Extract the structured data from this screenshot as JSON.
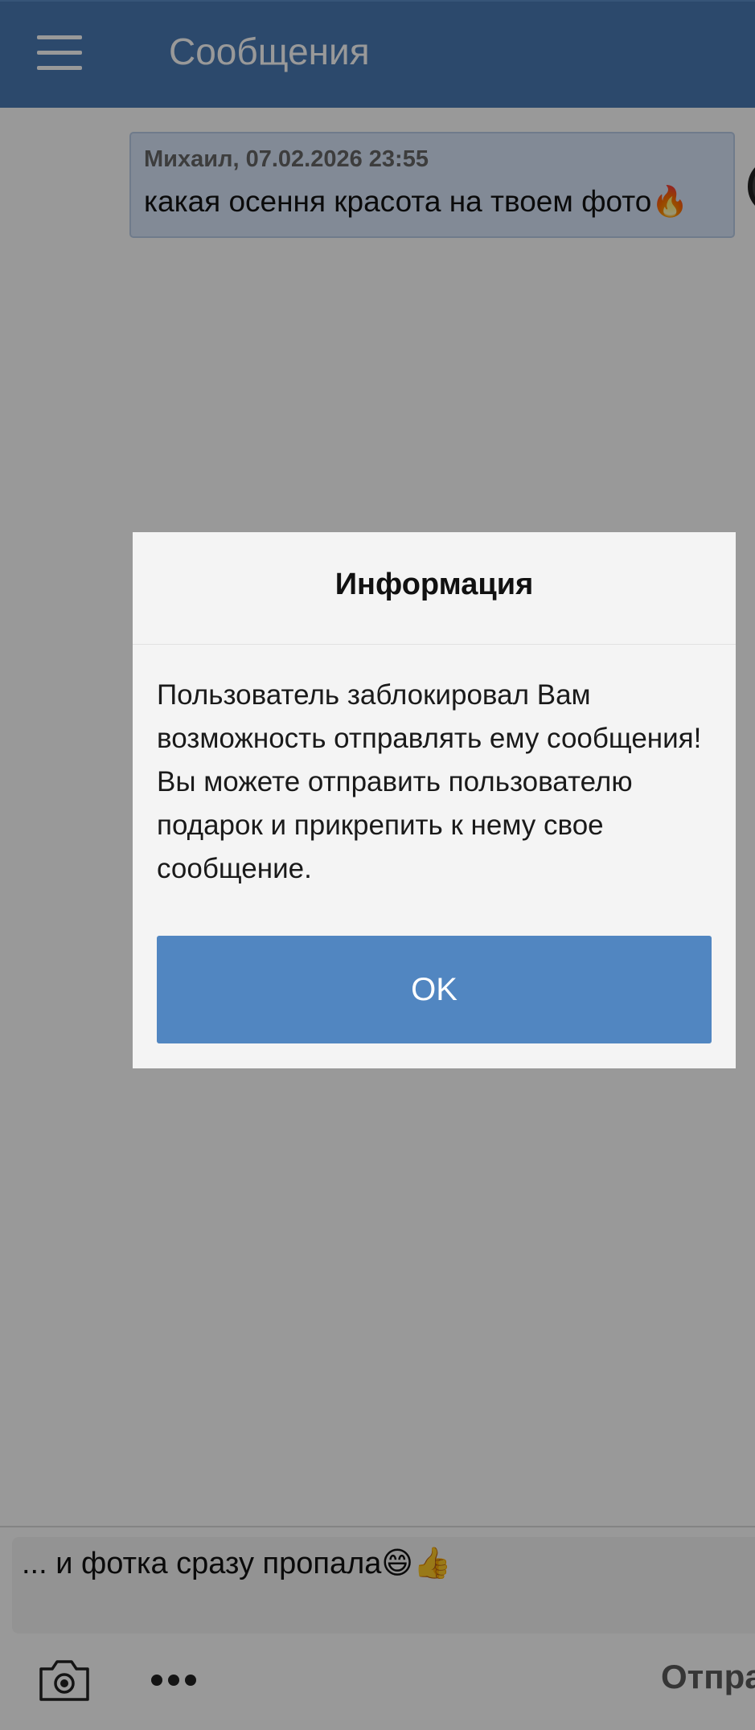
{
  "header": {
    "title": "Сообщения",
    "menu_icon": "hamburger-menu-icon"
  },
  "messages": [
    {
      "meta": "Михаил, 07.02.2026 23:55",
      "text": "какая осення красота на твоем фото🔥"
    }
  ],
  "composer": {
    "value": "... и фотка сразу пропала😄👍",
    "camera_icon": "camera-icon",
    "more_icon": "more-dots-icon",
    "send_label": "Отправить"
  },
  "dialog": {
    "title": "Информация",
    "body": "Пользователь заблокировал Вам возможность отправлять ему сообщения! Вы можете отправить пользователю подарок и прикрепить к нему свое сообщение.",
    "ok_label": "OK"
  },
  "colors": {
    "header": "#4a7ab5",
    "bubble": "#d9e7fb",
    "button": "#5186c1"
  }
}
